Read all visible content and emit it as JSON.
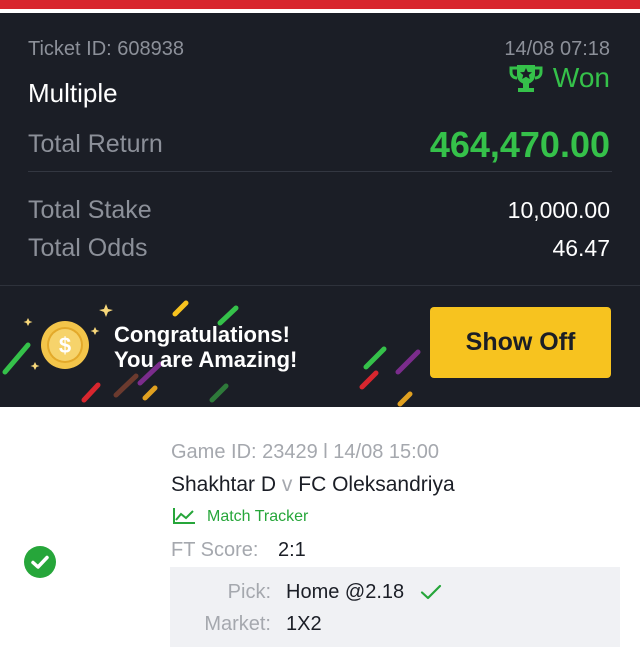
{
  "ticket": {
    "id_label": "Ticket ID: 608938",
    "datetime": "14/08 07:18",
    "bet_type": "Multiple",
    "status": "Won",
    "total_return_label": "Total Return",
    "total_return_value": "464,470.00",
    "total_stake_label": "Total Stake",
    "total_stake_value": "10,000.00",
    "total_odds_label": "Total Odds",
    "total_odds_value": "46.47"
  },
  "promo": {
    "line1": "Congratulations!",
    "line2": "You are Amazing!",
    "show_off_label": "Show Off"
  },
  "game": {
    "id_line": "Game ID: 23429 l 14/08 15:00",
    "home_team": "Shakhtar D",
    "vs": "v",
    "away_team": "FC Oleksandriya",
    "match_tracker_label": "Match Tracker",
    "ft_score_label": "FT Score:",
    "ft_score_value": "2:1",
    "pick_label": "Pick:",
    "pick_value": "Home @2.18",
    "market_label": "Market:",
    "market_value": "1X2"
  },
  "colors": {
    "brand_red": "#d8262e",
    "win_green": "#35c14a",
    "dark_bg": "#1b1e26",
    "button_yellow": "#f7c31f"
  },
  "icons": [
    "trophy-icon",
    "coin-icon",
    "chart-line-icon",
    "checkmark-icon",
    "check-circle-icon"
  ]
}
